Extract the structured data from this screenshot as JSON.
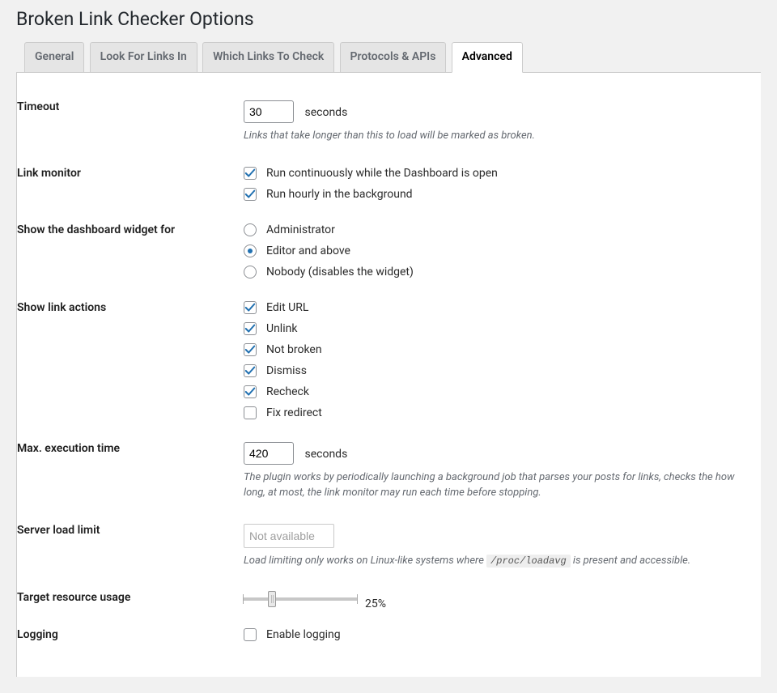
{
  "page_title": "Broken Link Checker Options",
  "tabs": {
    "general": "General",
    "look_for": "Look For Links In",
    "which_links": "Which Links To Check",
    "protocols": "Protocols & APIs",
    "advanced": "Advanced"
  },
  "active_tab": "advanced",
  "timeout": {
    "label": "Timeout",
    "value": "30",
    "unit": "seconds",
    "description": "Links that take longer than this to load will be marked as broken."
  },
  "link_monitor": {
    "label": "Link monitor",
    "opt1": {
      "label": "Run continuously while the Dashboard is open",
      "checked": true
    },
    "opt2": {
      "label": "Run hourly in the background",
      "checked": true
    }
  },
  "dashboard_widget": {
    "label": "Show the dashboard widget for",
    "opt1": "Administrator",
    "opt2": "Editor and above",
    "opt3": "Nobody (disables the widget)",
    "selected": "opt2"
  },
  "link_actions": {
    "label": "Show link actions",
    "opt1": {
      "label": "Edit URL",
      "checked": true
    },
    "opt2": {
      "label": "Unlink",
      "checked": true
    },
    "opt3": {
      "label": "Not broken",
      "checked": true
    },
    "opt4": {
      "label": "Dismiss",
      "checked": true
    },
    "opt5": {
      "label": "Recheck",
      "checked": true
    },
    "opt6": {
      "label": "Fix redirect",
      "checked": false
    }
  },
  "max_exec": {
    "label": "Max. execution time",
    "value": "420",
    "unit": "seconds",
    "description": "The plugin works by periodically launching a background job that parses your posts for links, checks the how long, at most, the link monitor may run each time before stopping."
  },
  "server_load": {
    "label": "Server load limit",
    "value": "Not available",
    "description_pre": "Load limiting only works on Linux-like systems where ",
    "path": "/proc/loadavg",
    "description_post": " is present and accessible."
  },
  "target_resource": {
    "label": "Target resource usage",
    "percent": 25,
    "display": "25%"
  },
  "logging": {
    "label": "Logging",
    "opt1": {
      "label": "Enable logging",
      "checked": false
    }
  }
}
